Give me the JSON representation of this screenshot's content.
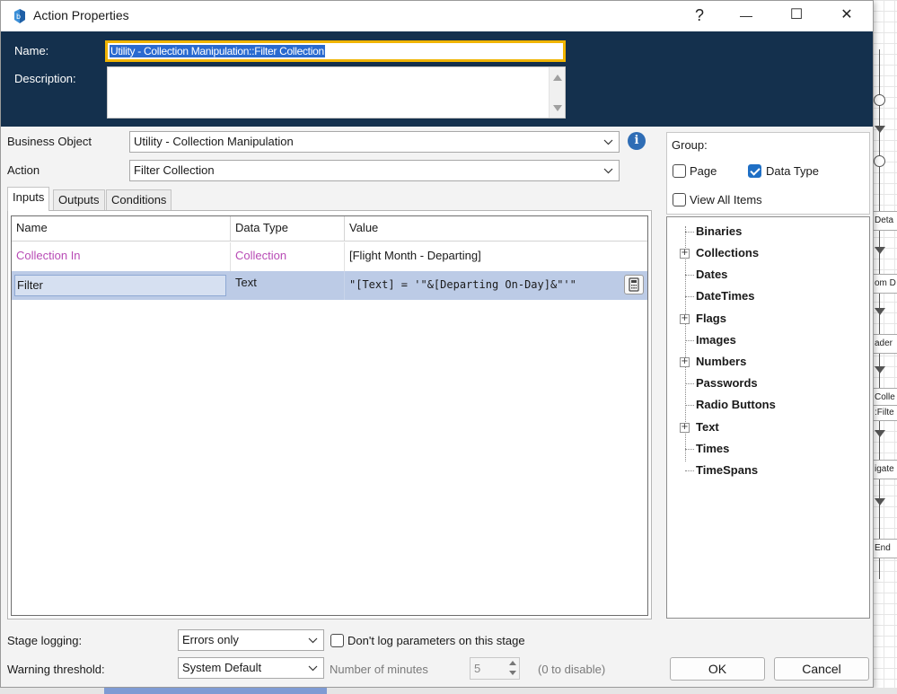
{
  "window": {
    "title": "Action Properties",
    "help_glyph": "?",
    "minimize_glyph": "—",
    "maximize_glyph": "☐",
    "close_glyph": "✕"
  },
  "header": {
    "name_label": "Name:",
    "name_value": "Utility - Collection Manipulation::Filter Collection",
    "description_label": "Description:",
    "description_value": ""
  },
  "form": {
    "business_object_label": "Business Object",
    "business_object_value": "Utility - Collection Manipulation",
    "action_label": "Action",
    "action_value": "Filter Collection"
  },
  "tabs": [
    {
      "label": "Inputs",
      "active": true
    },
    {
      "label": "Outputs",
      "active": false
    },
    {
      "label": "Conditions",
      "active": false
    }
  ],
  "grid": {
    "headers": [
      "Name",
      "Data Type",
      "Value"
    ],
    "rows": [
      {
        "name": "Collection In",
        "data_type": "Collection",
        "value": "[Flight Month - Departing]"
      },
      {
        "name": "Filter",
        "data_type": "Text",
        "value": "\"[Text] = '\"&[Departing On-Day]&\"'\""
      }
    ]
  },
  "group": {
    "label": "Group:",
    "page_label": "Page",
    "page_checked": false,
    "data_type_label": "Data Type",
    "data_type_checked": true,
    "view_all_label": "View All Items",
    "view_all_checked": false
  },
  "tree": [
    {
      "label": "Binaries",
      "expandable": false
    },
    {
      "label": "Collections",
      "expandable": true
    },
    {
      "label": "Dates",
      "expandable": false
    },
    {
      "label": "DateTimes",
      "expandable": false
    },
    {
      "label": "Flags",
      "expandable": true
    },
    {
      "label": "Images",
      "expandable": false
    },
    {
      "label": "Numbers",
      "expandable": true
    },
    {
      "label": "Passwords",
      "expandable": false
    },
    {
      "label": "Radio Buttons",
      "expandable": false
    },
    {
      "label": "Text",
      "expandable": true
    },
    {
      "label": "Times",
      "expandable": false
    },
    {
      "label": "TimeSpans",
      "expandable": false
    }
  ],
  "bottom": {
    "stage_logging_label": "Stage logging:",
    "stage_logging_value": "Errors only",
    "dont_log_label": "Don't log parameters on this stage",
    "dont_log_checked": false,
    "warning_label": "Warning threshold:",
    "warning_value": "System Default",
    "minutes_label": "Number of minutes",
    "minutes_value": "5",
    "disable_hint": "(0 to disable)",
    "ok_label": "OK",
    "cancel_label": "Cancel"
  },
  "background_flow": {
    "stages": [
      "Deta",
      "om D",
      "ader",
      "Colle",
      ":Filte",
      "igate",
      "End"
    ]
  },
  "colors": {
    "header_band": "#14304d",
    "name_highlight": "#f0b400",
    "selection": "#2a6ad0",
    "pink_text": "#b84bb5",
    "selected_row": "#bccbe6",
    "checkbox_on": "#1f6fc5"
  }
}
